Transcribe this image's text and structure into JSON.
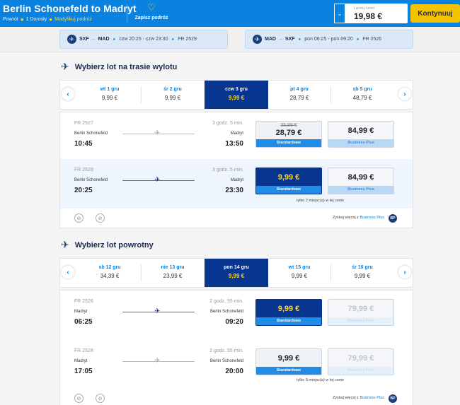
{
  "header": {
    "title": "Berlin Schonefeld to Madryt",
    "trip_type": "Powrót",
    "passengers": "1 Dorosły",
    "modify": "Modyfikuj podróż",
    "save_label": "Zapisz podróż",
    "price_label": "Łączny koszt",
    "total": "19,98 €",
    "continue": "Kontynuuj"
  },
  "summary": {
    "outbound": {
      "from": "SXF",
      "to": "MAD",
      "dates": "czw 20:25 - czw 23:30",
      "flight": "FR 2529"
    },
    "inbound": {
      "from": "MAD",
      "to": "SXF",
      "dates": "pon 06:25 - pon 09:20",
      "flight": "FR 2526"
    }
  },
  "outbound": {
    "title": "Wybierz lot na trasie wylotu",
    "dates": [
      {
        "day": "wt 1 gru",
        "price": "9,99 €"
      },
      {
        "day": "śr 2 gru",
        "price": "9,99 €"
      },
      {
        "day": "czw 3 gru",
        "price": "9,99 €",
        "active": true
      },
      {
        "day": "pt 4 gru",
        "price": "28,79 €"
      },
      {
        "day": "sb 5 gru",
        "price": "48,79 €"
      }
    ],
    "flights": [
      {
        "number": "FR 2527",
        "from": "Berlin Schonefeld",
        "dep": "10:45",
        "duration": "3 godz. 5 min.",
        "to": "Madryt",
        "arr": "13:50",
        "std_old": "35,99 €",
        "std": "28,79 €",
        "std_tag": "Standardowe",
        "bp": "84,99 €",
        "bp_tag": "Business Plus"
      },
      {
        "number": "FR 2529",
        "from": "Berlin Schonefeld",
        "dep": "20:25",
        "duration": "3 godz. 5 min.",
        "to": "Madryt",
        "arr": "23:30",
        "std": "9,99 €",
        "std_tag": "Standardowe",
        "bp": "84,99 €",
        "bp_tag": "Business Plus",
        "note": "tylko 2 miejsc(a) w tej cenie"
      }
    ],
    "more_prefix": "Zyskaj więcej z",
    "more_link": "Business Plus"
  },
  "inbound": {
    "title": "Wybierz lot powrotny",
    "dates": [
      {
        "day": "sb 12 gru",
        "price": "34,39 €"
      },
      {
        "day": "nie 13 gru",
        "price": "23,99 €"
      },
      {
        "day": "pon 14 gru",
        "price": "9,99 €",
        "active": true
      },
      {
        "day": "wt 15 gru",
        "price": "9,99 €"
      },
      {
        "day": "śr 16 gru",
        "price": "9,99 €"
      }
    ],
    "flights": [
      {
        "number": "FR 2526",
        "from": "Madryt",
        "dep": "06:25",
        "duration": "2 godz. 55 min.",
        "to": "Berlin Schonefeld",
        "arr": "09:20",
        "std": "9,99 €",
        "std_tag": "Standardowe",
        "bp": "79,99 €",
        "bp_tag": "Business Plus"
      },
      {
        "number": "FR 2528",
        "from": "Madryt",
        "dep": "17:05",
        "duration": "2 godz. 55 min.",
        "to": "Berlin Schonefeld",
        "arr": "20:00",
        "std": "9,99 €",
        "std_tag": "Standardowe",
        "bp": "79,99 €",
        "bp_tag": "Business Plus",
        "note": "tylko 5 miejsc(a) w tej cenie"
      }
    ],
    "more_prefix": "Zyskaj więcej z",
    "more_link": "Business Plus"
  },
  "colors": {
    "brand": "#0a83e0",
    "navy": "#073590",
    "yellow": "#ffd428",
    "button": "#f5c400"
  }
}
